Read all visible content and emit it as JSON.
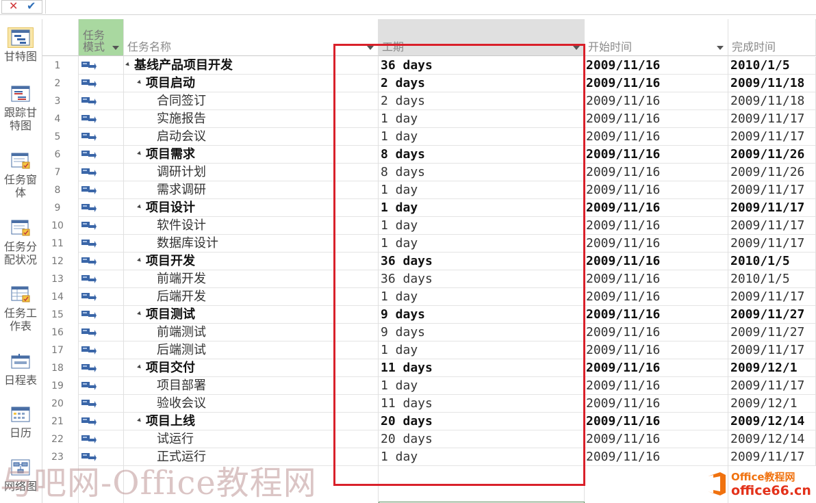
{
  "entry_bar": {
    "cancel_icon": "✕",
    "ok_icon": "✔"
  },
  "view_bar": {
    "items": [
      {
        "label": "甘特图",
        "icon": "gantt-chart-icon",
        "active": true
      },
      {
        "label": "跟踪甘特图",
        "icon": "tracking-gantt-icon"
      },
      {
        "label": "任务窗体",
        "icon": "task-form-icon"
      },
      {
        "label": "任务分配状况",
        "icon": "task-usage-icon"
      },
      {
        "label": "任务工作表",
        "icon": "task-sheet-icon"
      },
      {
        "label": "日程表",
        "icon": "timeline-icon"
      },
      {
        "label": "日历",
        "icon": "calendar-icon"
      },
      {
        "label": "网络图",
        "icon": "network-diagram-icon"
      }
    ]
  },
  "columns": {
    "mode": "任务模式",
    "name": "任务名称",
    "duration": "工期",
    "start": "开始时间",
    "finish": "完成时间"
  },
  "tasks": [
    {
      "id": "1",
      "name": "基线产品项目开发",
      "duration": "36 days",
      "start": "2009/11/16",
      "finish": "2010/1/5",
      "level": 0,
      "summary": true
    },
    {
      "id": "2",
      "name": "项目启动",
      "duration": "2 days",
      "start": "2009/11/16",
      "finish": "2009/11/18",
      "level": 1,
      "summary": true
    },
    {
      "id": "3",
      "name": "合同签订",
      "duration": "2 days",
      "start": "2009/11/16",
      "finish": "2009/11/18",
      "level": 2,
      "summary": false
    },
    {
      "id": "4",
      "name": "实施报告",
      "duration": "1 day",
      "start": "2009/11/16",
      "finish": "2009/11/17",
      "level": 2,
      "summary": false
    },
    {
      "id": "5",
      "name": "启动会议",
      "duration": "1 day",
      "start": "2009/11/16",
      "finish": "2009/11/17",
      "level": 2,
      "summary": false
    },
    {
      "id": "6",
      "name": "项目需求",
      "duration": "8 days",
      "start": "2009/11/16",
      "finish": "2009/11/26",
      "level": 1,
      "summary": true
    },
    {
      "id": "7",
      "name": "调研计划",
      "duration": "8 days",
      "start": "2009/11/16",
      "finish": "2009/11/26",
      "level": 2,
      "summary": false
    },
    {
      "id": "8",
      "name": "需求调研",
      "duration": "1 day",
      "start": "2009/11/16",
      "finish": "2009/11/17",
      "level": 2,
      "summary": false
    },
    {
      "id": "9",
      "name": "项目设计",
      "duration": "1 day",
      "start": "2009/11/16",
      "finish": "2009/11/17",
      "level": 1,
      "summary": true
    },
    {
      "id": "10",
      "name": "软件设计",
      "duration": "1 day",
      "start": "2009/11/16",
      "finish": "2009/11/17",
      "level": 2,
      "summary": false
    },
    {
      "id": "11",
      "name": "数据库设计",
      "duration": "1 day",
      "start": "2009/11/16",
      "finish": "2009/11/17",
      "level": 2,
      "summary": false
    },
    {
      "id": "12",
      "name": "项目开发",
      "duration": "36 days",
      "start": "2009/11/16",
      "finish": "2010/1/5",
      "level": 1,
      "summary": true
    },
    {
      "id": "13",
      "name": "前端开发",
      "duration": "36 days",
      "start": "2009/11/16",
      "finish": "2010/1/5",
      "level": 2,
      "summary": false
    },
    {
      "id": "14",
      "name": "后端开发",
      "duration": "1 day",
      "start": "2009/11/16",
      "finish": "2009/11/17",
      "level": 2,
      "summary": false
    },
    {
      "id": "15",
      "name": "项目测试",
      "duration": "9 days",
      "start": "2009/11/16",
      "finish": "2009/11/27",
      "level": 1,
      "summary": true
    },
    {
      "id": "16",
      "name": "前端测试",
      "duration": "9 days",
      "start": "2009/11/16",
      "finish": "2009/11/27",
      "level": 2,
      "summary": false
    },
    {
      "id": "17",
      "name": "后端测试",
      "duration": "1 day",
      "start": "2009/11/16",
      "finish": "2009/11/17",
      "level": 2,
      "summary": false
    },
    {
      "id": "18",
      "name": "项目交付",
      "duration": "11 days",
      "start": "2009/11/16",
      "finish": "2009/12/1",
      "level": 1,
      "summary": true
    },
    {
      "id": "19",
      "name": "项目部署",
      "duration": "1 day",
      "start": "2009/11/16",
      "finish": "2009/11/17",
      "level": 2,
      "summary": false
    },
    {
      "id": "20",
      "name": "验收会议",
      "duration": "11 days",
      "start": "2009/11/16",
      "finish": "2009/12/1",
      "level": 2,
      "summary": false
    },
    {
      "id": "21",
      "name": "项目上线",
      "duration": "20 days",
      "start": "2009/11/16",
      "finish": "2009/12/14",
      "level": 1,
      "summary": true
    },
    {
      "id": "22",
      "name": "试运行",
      "duration": "20 days",
      "start": "2009/11/16",
      "finish": "2009/12/14",
      "level": 2,
      "summary": false
    },
    {
      "id": "23",
      "name": "正式运行",
      "duration": "1 day",
      "start": "2009/11/16",
      "finish": "2009/11/17",
      "level": 2,
      "summary": false
    }
  ],
  "watermark": {
    "text": "与吧网-Office教程网"
  },
  "brand": {
    "top": "Office教程网",
    "bottom": "office66.cn"
  },
  "colors": {
    "highlight": "#d9202a",
    "mode_header": "#a9d8a0",
    "brand_orange": "#f0720f",
    "brand_red": "#e3311a"
  }
}
